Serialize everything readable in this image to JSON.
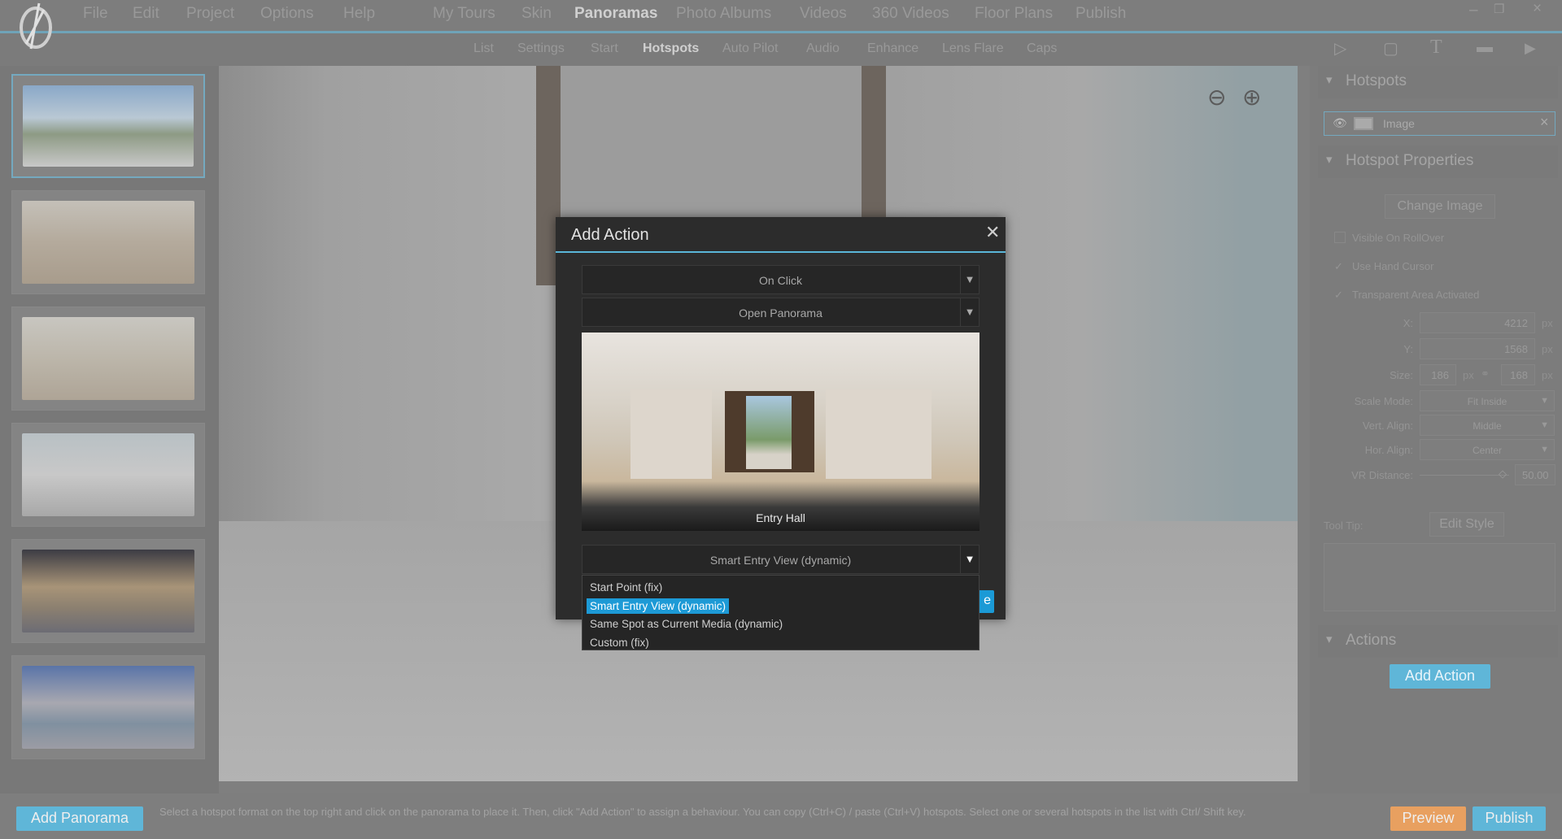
{
  "menu": {
    "items": [
      "File",
      "Edit",
      "Project",
      "Options",
      "Help"
    ],
    "sections": [
      "My Tours",
      "Skin",
      "Panoramas",
      "Photo Albums",
      "Videos",
      "360 Videos",
      "Floor Plans",
      "Publish"
    ],
    "active_section": "Panoramas",
    "window_controls": [
      "minimize-icon",
      "restore-icon",
      "close-icon"
    ]
  },
  "subtabs": {
    "items": [
      "List",
      "Settings",
      "Start",
      "Hotspots",
      "Auto Pilot",
      "Audio",
      "Enhance",
      "Lens Flare",
      "Caps"
    ],
    "active": "Hotspots",
    "tool_icons": [
      "polygon-icon",
      "rectangle-icon",
      "text-icon",
      "image-icon",
      "video-icon"
    ]
  },
  "sidebar": {
    "thumbnails": 6,
    "selected": 0
  },
  "right_panel": {
    "hotspots_title": "Hotspots",
    "hotspot_item": "Image",
    "properties_title": "Hotspot Properties",
    "change_image": "Change Image",
    "checks": [
      {
        "label": "Visible On RollOver",
        "checked": false
      },
      {
        "label": "Use Hand Cursor",
        "checked": true
      },
      {
        "label": "Transparent Area Activated",
        "checked": true
      }
    ],
    "x_label": "X:",
    "x": "4212",
    "y_label": "Y:",
    "y": "1568",
    "unit": "px",
    "size_label": "Size:",
    "size_w": "186",
    "size_h": "168",
    "scale_label": "Scale Mode:",
    "scale": "Fit Inside",
    "valign_label": "Vert. Align:",
    "valign": "Middle",
    "halign_label": "Hor. Align:",
    "halign": "Center",
    "vr_label": "VR Distance:",
    "vr": "50.00",
    "tooltip_label": "Tool Tip:",
    "edit_style": "Edit Style",
    "actions_title": "Actions",
    "add_action": "Add Action"
  },
  "bottom": {
    "add_panorama": "Add Panorama",
    "hint": "Select a hotspot format on the top right and click on the panorama to place it. Then, click \"Add Action\" to assign a behaviour. You can copy (Ctrl+C) / paste (Ctrl+V) hotspots. Select one or several hotspots in the list with Ctrl/ Shift key.",
    "preview": "Preview",
    "publish": "Publish"
  },
  "dialog": {
    "title": "Add Action",
    "trigger": "On Click",
    "action": "Open Panorama",
    "panorama_name": "Entry Hall",
    "view": "Smart Entry View (dynamic)",
    "options": [
      "Start Point (fix)",
      "Smart Entry View (dynamic)",
      "Same Spot as Current Media (dynamic)",
      "Custom (fix)"
    ],
    "highlighted": 1,
    "ok_partial": "e"
  },
  "colors": {
    "accent": "#1d9ad6",
    "preview": "#e8a060",
    "publish": "#5fb6d8"
  }
}
